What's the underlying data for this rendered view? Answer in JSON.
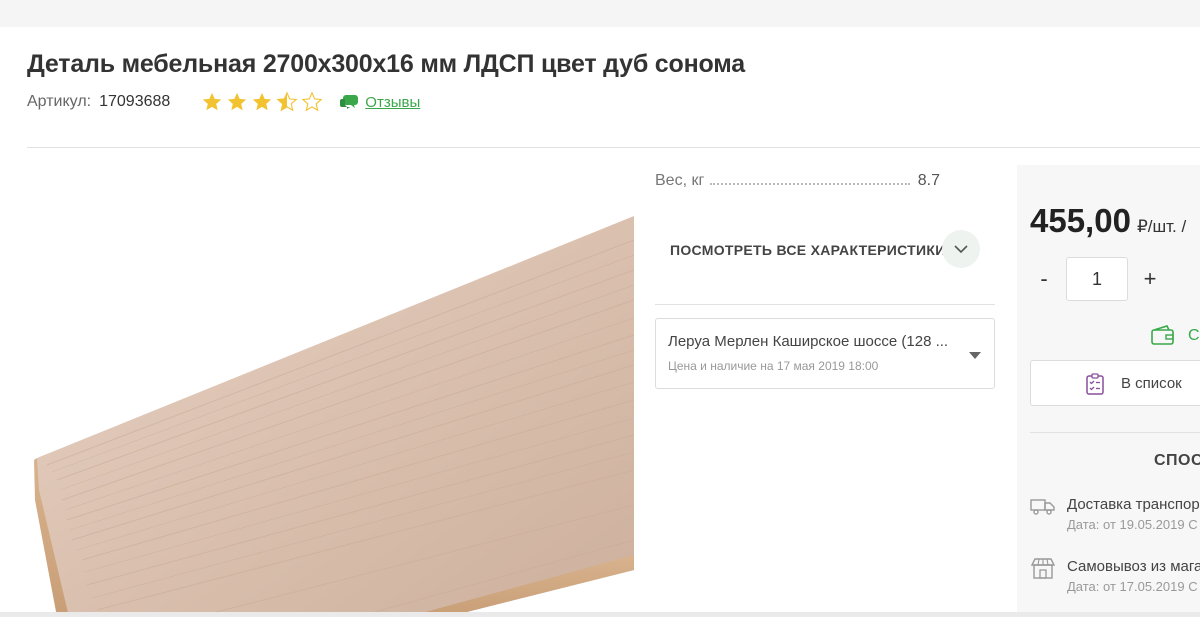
{
  "product": {
    "title": "Деталь мебельная 2700х300х16 мм ЛДСП цвет дуб сонома",
    "sku_label": "Артикул:",
    "sku": "17093688",
    "rating": 3.5,
    "rating_max": 5,
    "reviews_label": "Отзывы"
  },
  "specs": {
    "items": [
      {
        "name": "Вес, кг",
        "value": "8.7"
      }
    ],
    "all_label": "ПОСМОТРЕТЬ ВСЕ ХАРАКТЕРИСТИКИ"
  },
  "store": {
    "name": "Леруа Мерлен Каширское шоссе (128 ...",
    "note": "Цена и наличие на 17 мая 2019 18:00"
  },
  "buy": {
    "price": "455,00",
    "unit": "₽/шт. /",
    "quantity": "1",
    "minus": "-",
    "plus": "+",
    "wallet_text": "С",
    "to_list_label": "В список"
  },
  "delivery": {
    "title": "СПОС",
    "ways": [
      {
        "title": "Доставка транспор",
        "date": "Дата: от 19.05.2019   С"
      },
      {
        "title": "Самовывоз из мага",
        "date": "Дата: от 17.05.2019   С"
      }
    ]
  },
  "colors": {
    "accent": "#3aa84a",
    "star": "#f2c230",
    "text": "#333333",
    "muted": "#999999",
    "list_icon": "#8a4f9e"
  }
}
